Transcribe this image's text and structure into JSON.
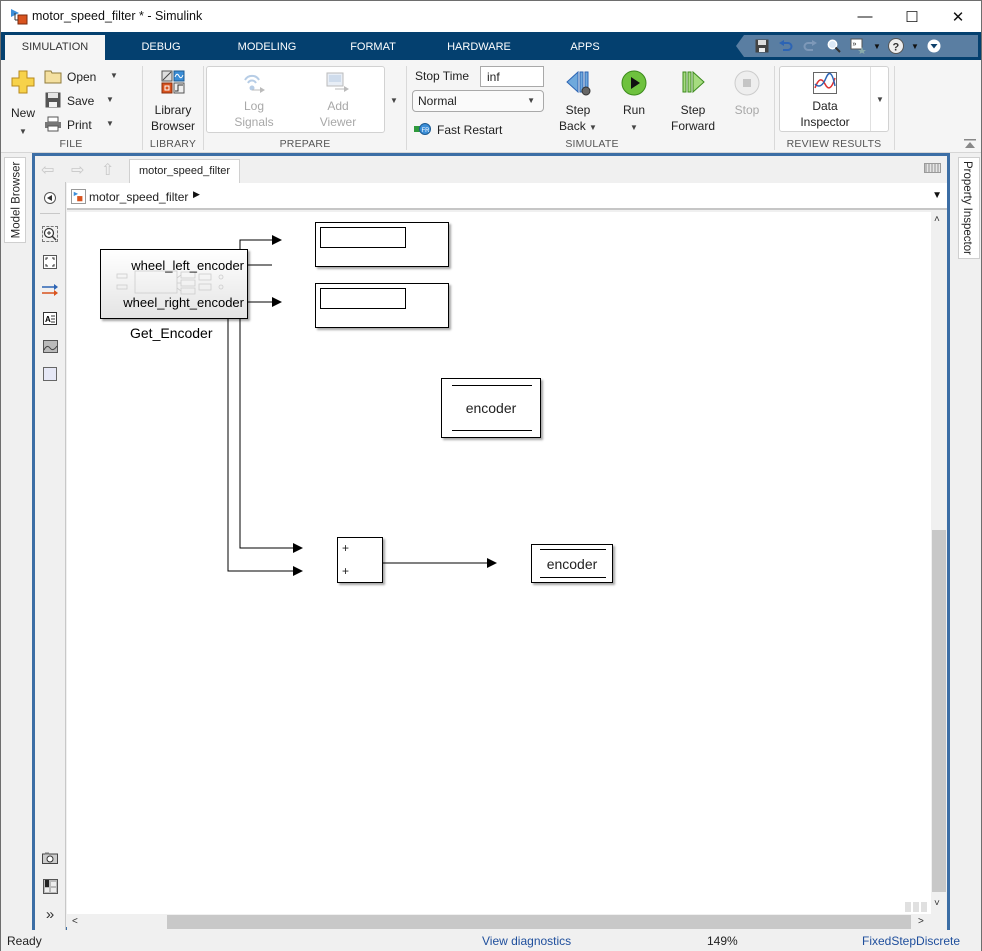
{
  "window": {
    "title": "motor_speed_filter * - Simulink",
    "controls": {
      "minimize": "—",
      "maximize": "☐",
      "close": "✕"
    }
  },
  "tabs": [
    {
      "label": "SIMULATION",
      "active": true
    },
    {
      "label": "DEBUG"
    },
    {
      "label": "MODELING"
    },
    {
      "label": "FORMAT"
    },
    {
      "label": "HARDWARE"
    },
    {
      "label": "APPS"
    }
  ],
  "quick_access": [
    "save-icon",
    "undo-icon",
    "redo-icon",
    "search-icon",
    "find-model-icon",
    "help-icon",
    "expand-icon"
  ],
  "ribbon": {
    "file": {
      "group_label": "FILE",
      "new_label": "New",
      "open_label": "Open",
      "save_label": "Save",
      "print_label": "Print"
    },
    "library": {
      "group_label": "LIBRARY",
      "library_browser_line1": "Library",
      "library_browser_line2": "Browser"
    },
    "prepare": {
      "group_label": "PREPARE",
      "log_signals_line1": "Log",
      "log_signals_line2": "Signals",
      "add_viewer_line1": "Add",
      "add_viewer_line2": "Viewer"
    },
    "simulate": {
      "group_label": "SIMULATE",
      "stop_time_label": "Stop Time",
      "stop_time_value": "inf",
      "mode_value": "Normal",
      "fast_restart_label": "Fast Restart",
      "step_back_line1": "Step",
      "step_back_line2": "Back",
      "run_label": "Run",
      "step_forward_line1": "Step",
      "step_forward_line2": "Forward",
      "stop_label": "Stop"
    },
    "review": {
      "group_label": "REVIEW RESULTS",
      "data_inspector_line1": "Data",
      "data_inspector_line2": "Inspector"
    }
  },
  "side_panels": {
    "left": "Model Browser",
    "right": "Property Inspector"
  },
  "editor": {
    "tab_label": "motor_speed_filter",
    "breadcrumb": "motor_speed_filter"
  },
  "diagram": {
    "subsystem": {
      "name": "Get_Encoder",
      "ports": [
        "wheel_left_encoder",
        "wheel_right_encoder"
      ]
    },
    "sum_block": {
      "signs": [
        "+",
        "+"
      ]
    },
    "goto_block_1": {
      "label": "encoder"
    },
    "goto_block_2": {
      "label": "encoder"
    }
  },
  "status": {
    "state": "Ready",
    "diagnostics_link": "View diagnostics",
    "zoom": "149%",
    "solver": "FixedStepDiscrete"
  }
}
